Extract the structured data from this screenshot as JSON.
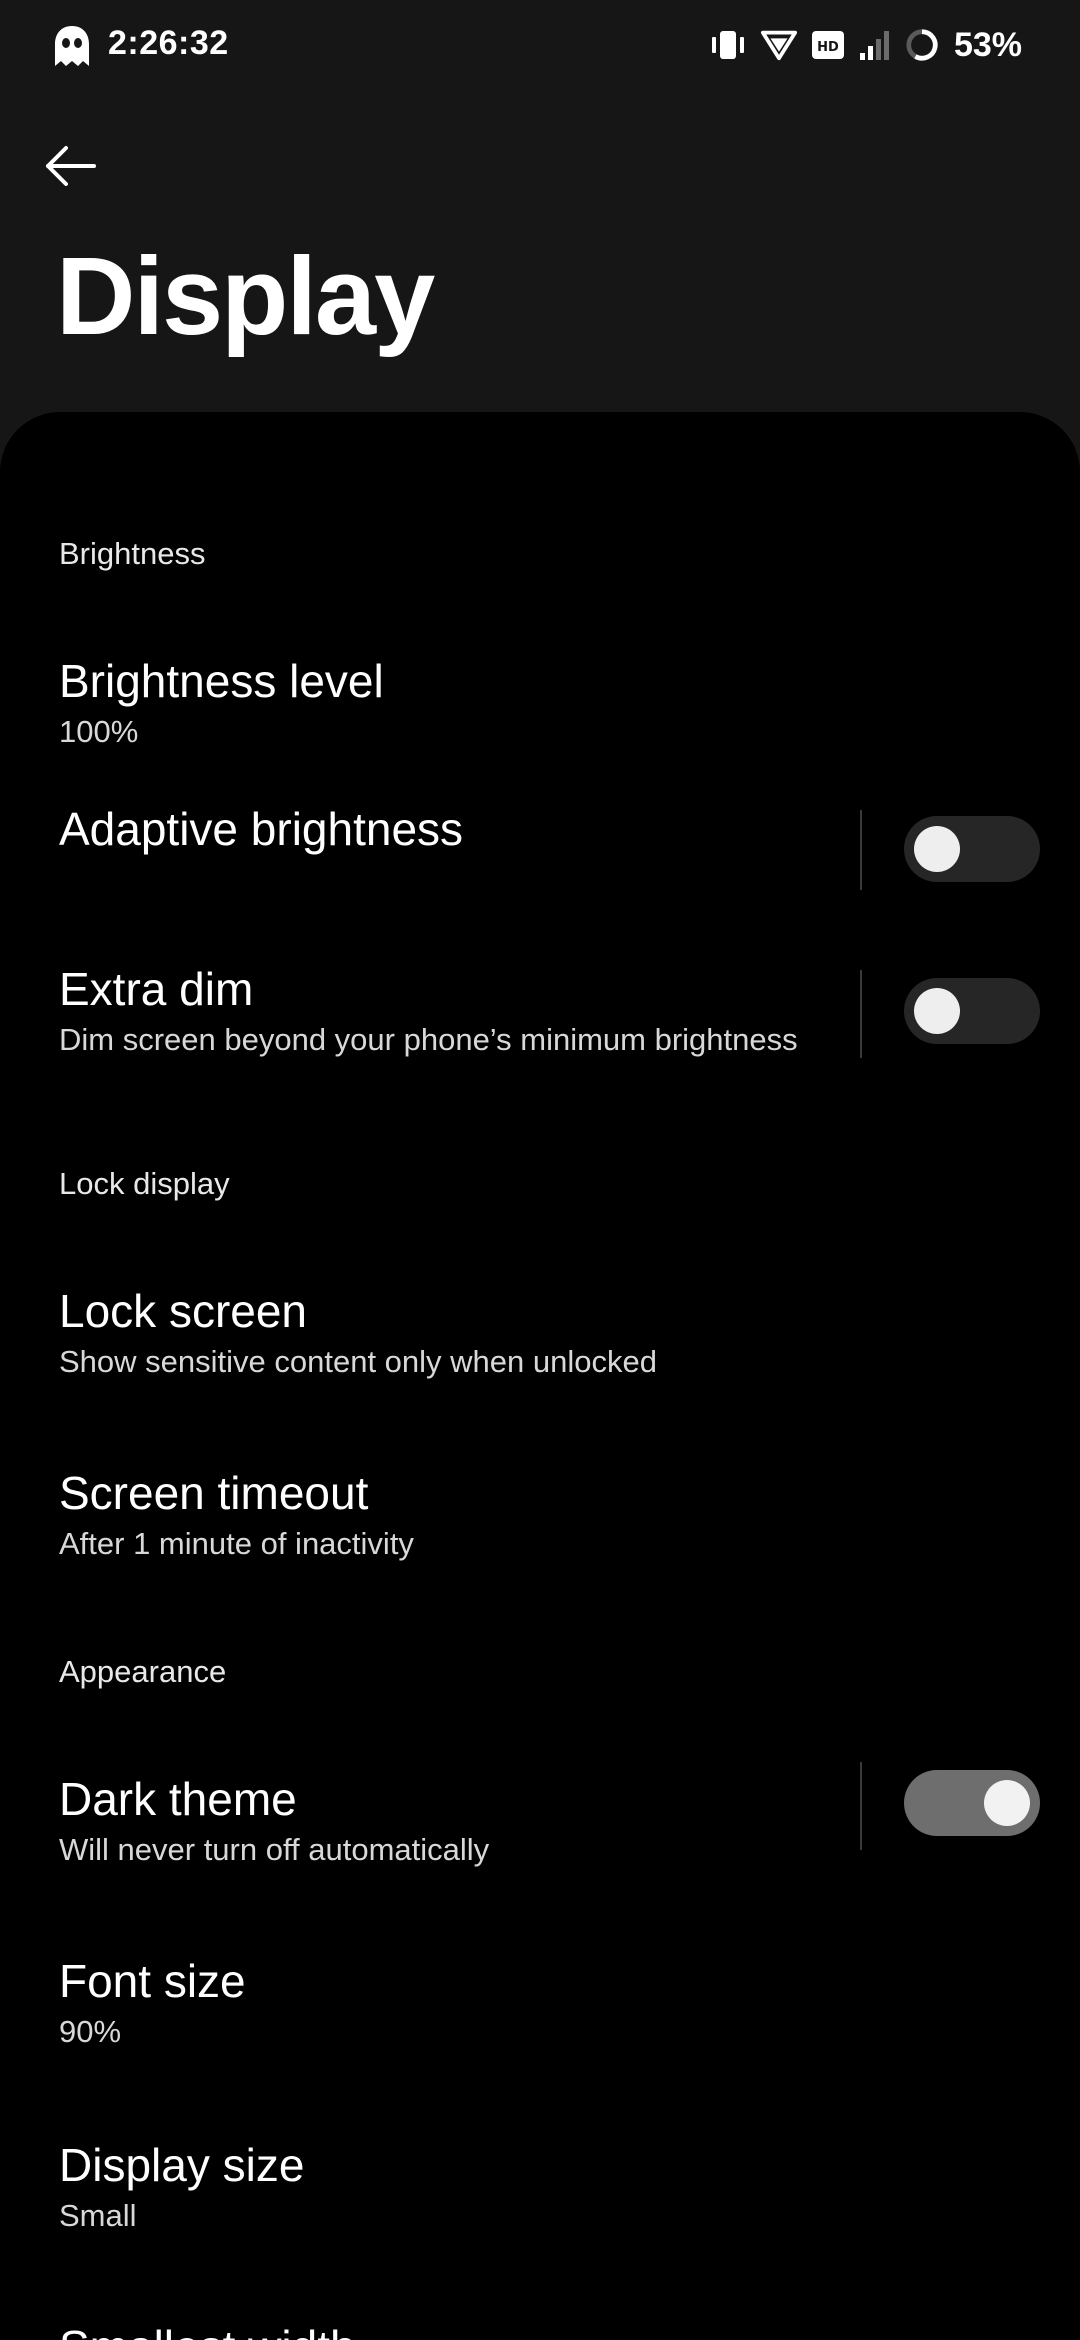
{
  "status_bar": {
    "time": "2:26:32",
    "battery": "53%",
    "icons": [
      "ghost-icon",
      "vibrate-icon",
      "wifi-icon",
      "hd-icon",
      "signal-icon",
      "battery-icon"
    ]
  },
  "header": {
    "title": "Display",
    "back_icon": "arrow-left-icon"
  },
  "sections": {
    "brightness": {
      "header": "Brightness",
      "brightness_level": {
        "title": "Brightness level",
        "subtitle": "100%"
      },
      "adaptive_brightness": {
        "title": "Adaptive brightness",
        "enabled": false
      },
      "extra_dim": {
        "title": "Extra dim",
        "subtitle": "Dim screen beyond your phone’s minimum brightness",
        "enabled": false
      }
    },
    "lock_display": {
      "header": "Lock display",
      "lock_screen": {
        "title": "Lock screen",
        "subtitle": "Show sensitive content only when unlocked"
      },
      "screen_timeout": {
        "title": "Screen timeout",
        "subtitle": "After 1 minute of inactivity"
      }
    },
    "appearance": {
      "header": "Appearance",
      "dark_theme": {
        "title": "Dark theme",
        "subtitle": "Will never turn off automatically",
        "enabled": true
      },
      "font_size": {
        "title": "Font size",
        "subtitle": "90%"
      },
      "display_size": {
        "title": "Display size",
        "subtitle": "Small"
      },
      "smallest_width": {
        "title": "Smallest width"
      }
    }
  },
  "colors": {
    "header_bg": "#161616",
    "panel_bg": "#000000",
    "toggle_off_track": "#262626",
    "toggle_on_track": "#6e6e6e"
  }
}
